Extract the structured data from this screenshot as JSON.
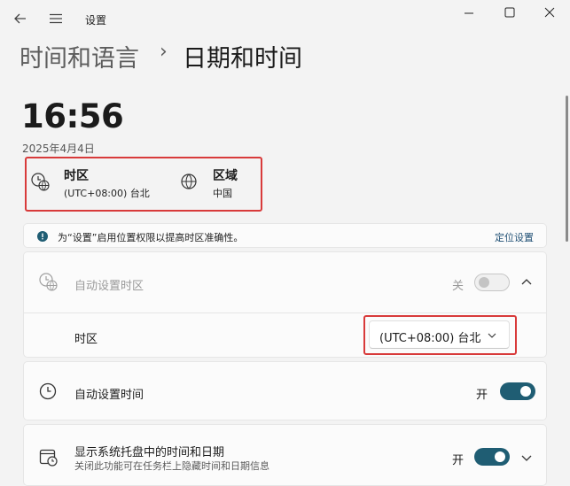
{
  "titlebar": {
    "title": "设置"
  },
  "breadcrumb": {
    "parent": "时间和语言",
    "separator": "›",
    "current": "日期和时间"
  },
  "clock": {
    "time": "16:56",
    "date": "2025年4月4日"
  },
  "info_tiles": [
    {
      "title": "时区",
      "value": "(UTC+08:00) 台北",
      "icon": "clock-globe-icon"
    },
    {
      "title": "区域",
      "value": "中国",
      "icon": "globe-icon"
    }
  ],
  "location_banner": {
    "text": "为“设置”启用位置权限以提高时区准确性。",
    "link": "定位设置"
  },
  "auto_timezone": {
    "label": "自动设置时区",
    "state": "关",
    "enabled": false
  },
  "timezone_row": {
    "label": "时区",
    "selected": "(UTC+08:00) 台北"
  },
  "auto_time": {
    "label": "自动设置时间",
    "state": "开",
    "enabled": true
  },
  "tray_clock": {
    "label": "显示系统托盘中的时间和日期",
    "sub": "关闭此功能可在任务栏上隐藏时间和日期信息",
    "state": "开",
    "enabled": true
  },
  "colors": {
    "accent": "#1f5d73",
    "highlight": "#d83a3a",
    "background": "#f3f3f3"
  }
}
